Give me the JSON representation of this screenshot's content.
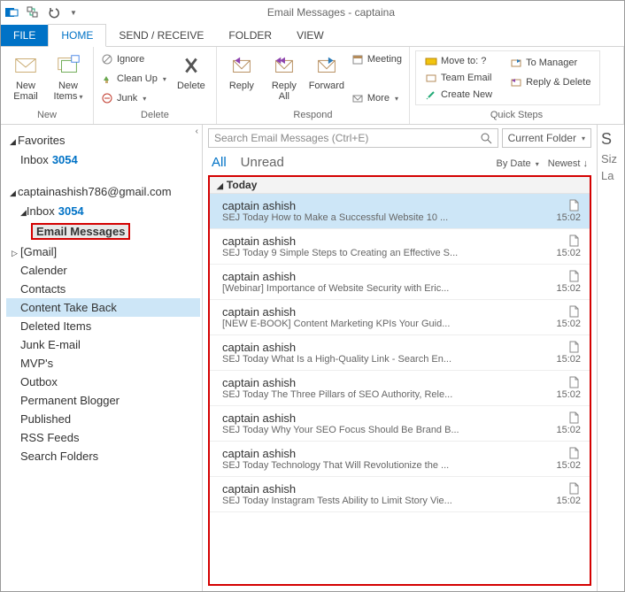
{
  "title": "Email Messages - captaina",
  "tabs": {
    "file": "FILE",
    "home": "HOME",
    "sendreceive": "SEND / RECEIVE",
    "folder": "FOLDER",
    "view": "VIEW"
  },
  "ribbon": {
    "new": {
      "label": "New",
      "new_email": "New\nEmail",
      "new_items": "New\nItems"
    },
    "delete": {
      "label": "Delete",
      "ignore": "Ignore",
      "cleanup": "Clean Up",
      "junk": "Junk",
      "delete_btn": "Delete"
    },
    "respond": {
      "label": "Respond",
      "reply": "Reply",
      "reply_all": "Reply\nAll",
      "forward": "Forward",
      "meeting": "Meeting",
      "more": "More"
    },
    "quicksteps": {
      "label": "Quick Steps",
      "moveto": "Move to: ?",
      "team_email": "Team Email",
      "create_new": "Create New",
      "to_manager": "To Manager",
      "reply_delete": "Reply & Delete"
    }
  },
  "nav": {
    "favorites": "Favorites",
    "inbox_label": "Inbox",
    "inbox_count": "3054",
    "account": "captainashish786@gmail.com",
    "email_messages": "Email Messages",
    "folders": [
      "[Gmail]",
      "Calender",
      "Contacts",
      "Content Take Back",
      "Deleted Items",
      "Junk E-mail",
      "MVP's",
      "Outbox",
      "Permanent Blogger",
      "Published",
      "RSS Feeds",
      "Search Folders"
    ]
  },
  "search": {
    "placeholder": "Search Email Messages (Ctrl+E)",
    "scope": "Current Folder"
  },
  "filters": {
    "all": "All",
    "unread": "Unread",
    "by_date": "By Date",
    "newest": "Newest"
  },
  "group_today": "Today",
  "messages": [
    {
      "from": "captain ashish",
      "subject": "SEJ Today  How to Make a Successful Website  10 ...",
      "time": "15:02"
    },
    {
      "from": "captain ashish",
      "subject": "SEJ Today  9 Simple Steps to Creating an Effective S...",
      "time": "15:02"
    },
    {
      "from": "captain ashish",
      "subject": "[Webinar] Importance of Website Security with Eric...",
      "time": "15:02"
    },
    {
      "from": "captain ashish",
      "subject": "[NEW E-BOOK] Content Marketing KPIs  Your Guid...",
      "time": "15:02"
    },
    {
      "from": "captain ashish",
      "subject": "SEJ Today   What Is a High-Quality Link  - Search En...",
      "time": "15:02"
    },
    {
      "from": "captain ashish",
      "subject": "SEJ Today  The Three Pillars of SEO  Authority, Rele...",
      "time": "15:02"
    },
    {
      "from": "captain ashish",
      "subject": "SEJ Today  Why Your SEO Focus Should Be Brand B...",
      "time": "15:02"
    },
    {
      "from": "captain ashish",
      "subject": "SEJ Today  Technology That Will Revolutionize the ...",
      "time": "15:02"
    },
    {
      "from": "captain ashish",
      "subject": "SEJ Today  Instagram Tests Ability to Limit Story Vie...",
      "time": "15:02"
    }
  ],
  "readpane": {
    "l1": "S",
    "l2": "Siz",
    "l3": "La"
  }
}
